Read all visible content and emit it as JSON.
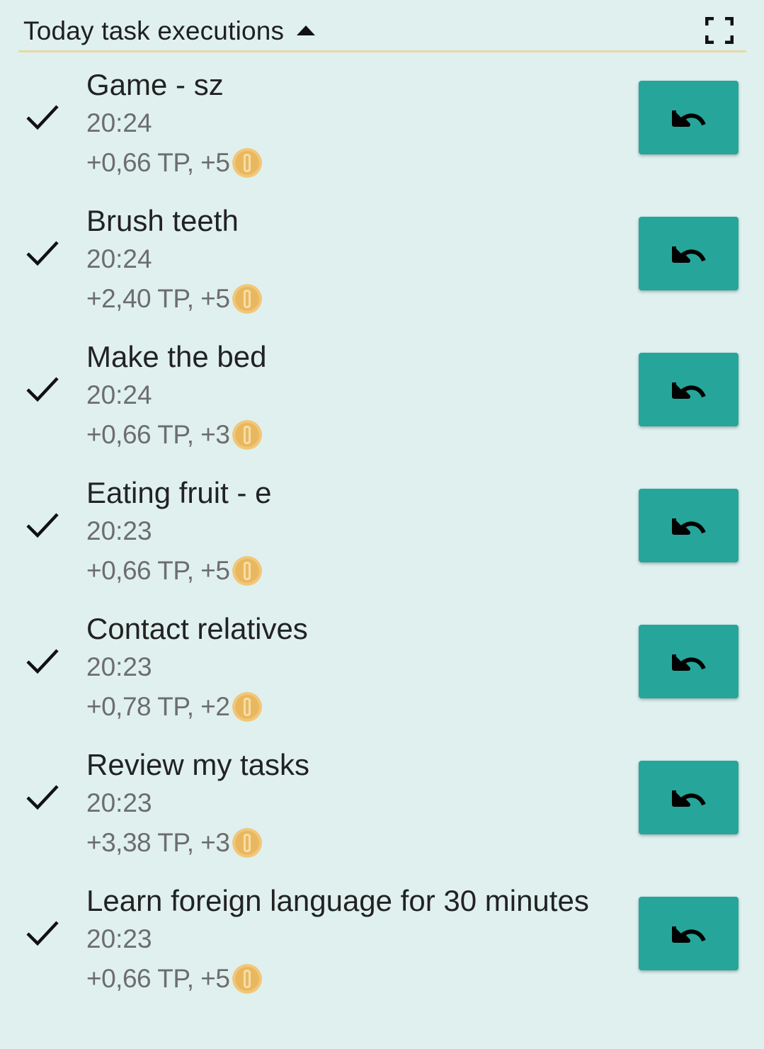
{
  "header": {
    "title": "Today task executions",
    "collapse_icon": "caret-up-icon",
    "fullscreen_icon": "fullscreen-icon"
  },
  "colors": {
    "background": "#dff0ef",
    "accent_button": "#26a69a",
    "divider": "#e7d9a6",
    "coin": "#e9b85e"
  },
  "tasks": [
    {
      "name": "Game - sz",
      "time": "20:24",
      "reward": "+0,66 TP, +5"
    },
    {
      "name": "Brush teeth",
      "time": "20:24",
      "reward": "+2,40 TP, +5"
    },
    {
      "name": "Make the bed",
      "time": "20:24",
      "reward": "+0,66 TP, +3"
    },
    {
      "name": "Eating fruit - e",
      "time": "20:23",
      "reward": "+0,66 TP, +5"
    },
    {
      "name": "Contact relatives",
      "time": "20:23",
      "reward": "+0,78 TP, +2"
    },
    {
      "name": "Review my tasks",
      "time": "20:23",
      "reward": "+3,38 TP, +3"
    },
    {
      "name": "Learn foreign language for 30 minutes",
      "time": "20:23",
      "reward": "+0,66 TP, +5"
    }
  ]
}
